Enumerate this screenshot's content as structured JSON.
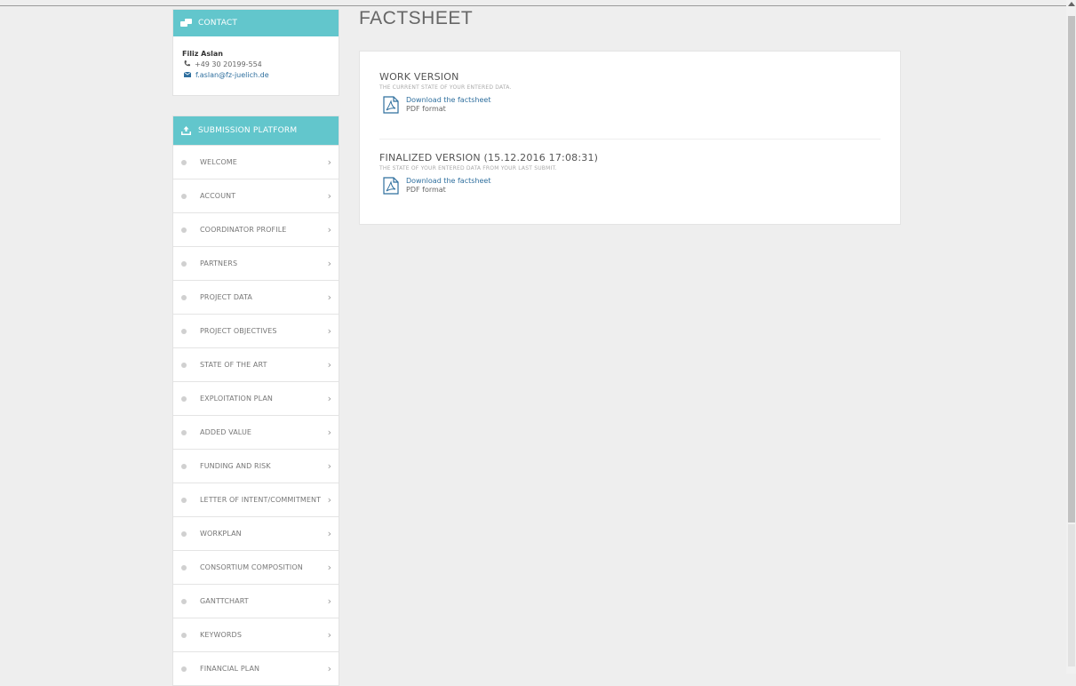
{
  "page": {
    "title": "FACTSHEET"
  },
  "contact": {
    "header": "CONTACT",
    "name": "Filiz Aslan",
    "phone": "+49 30 20199-554",
    "email": "f.aslan@fz-juelich.de"
  },
  "submission": {
    "header": "SUBMISSION PLATFORM",
    "items": [
      {
        "label": "WELCOME"
      },
      {
        "label": "ACCOUNT"
      },
      {
        "label": "COORDINATOR PROFILE"
      },
      {
        "label": "PARTNERS"
      },
      {
        "label": "PROJECT DATA"
      },
      {
        "label": "PROJECT OBJECTIVES"
      },
      {
        "label": "STATE OF THE ART"
      },
      {
        "label": "EXPLOITATION PLAN"
      },
      {
        "label": "ADDED VALUE"
      },
      {
        "label": "FUNDING AND RISK"
      },
      {
        "label": "LETTER OF INTENT/COMMITMENT"
      },
      {
        "label": "WORKPLAN"
      },
      {
        "label": "CONSORTIUM COMPOSITION"
      },
      {
        "label": "GANTTCHART"
      },
      {
        "label": "KEYWORDS"
      },
      {
        "label": "FINANCIAL PLAN"
      }
    ]
  },
  "work": {
    "title": "WORK VERSION",
    "subtitle": "THE CURRENT STATE OF YOUR ENTERED DATA.",
    "link": "Download the factsheet",
    "format": "PDF format"
  },
  "final": {
    "title": "FINALIZED VERSION (15.12.2016 17:08:31)",
    "subtitle": "THE STATE OF YOUR ENTERED DATA FROM YOUR LAST SUBMIT.",
    "link": "Download the factsheet",
    "format": "PDF format"
  },
  "colors": {
    "accent": "#62c6cc",
    "link": "#2f6f9e"
  },
  "icons": {
    "contact": "chat-bubbles-icon",
    "submission": "upload-tray-icon",
    "phone": "phone-icon",
    "email": "envelope-icon",
    "pdf": "pdf-file-icon",
    "chevron": "chevron-right-icon"
  }
}
